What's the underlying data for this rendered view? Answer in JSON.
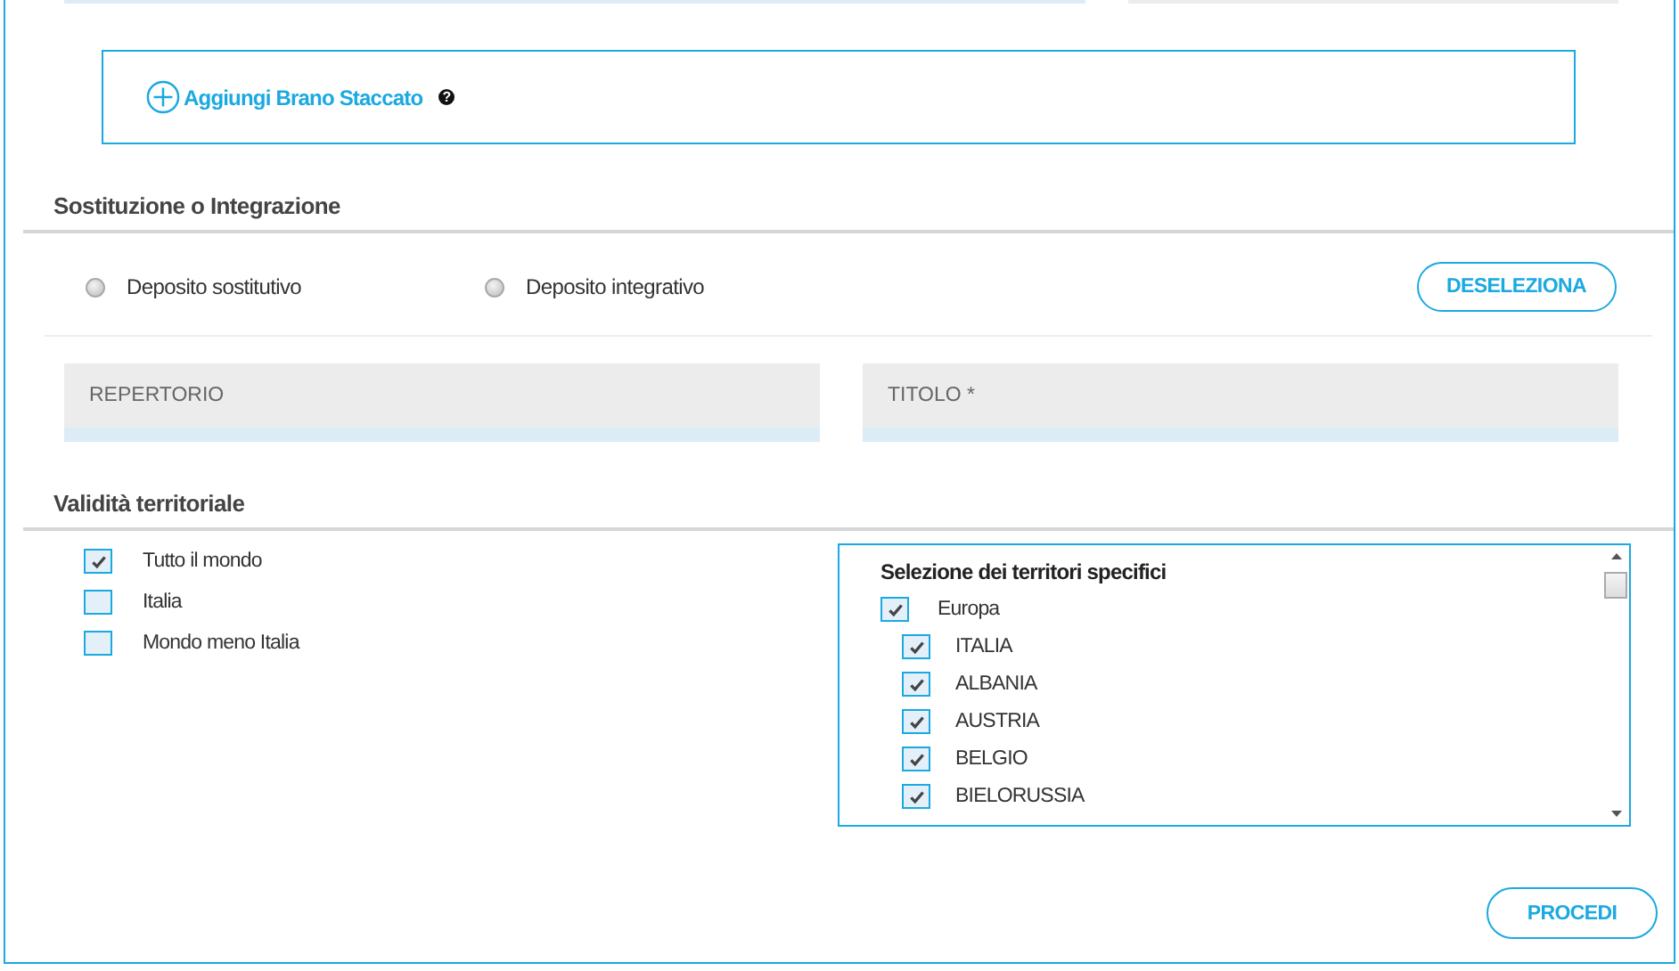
{
  "add_excerpt": {
    "label": "Aggiungi Brano Staccato",
    "help": "?"
  },
  "replacement": {
    "title": "Sostituzione o Integrazione",
    "options": [
      {
        "label": "Deposito sostitutivo",
        "selected": false
      },
      {
        "label": "Deposito integrativo",
        "selected": false
      }
    ],
    "clear_button": "DESELEZIONA"
  },
  "fields": [
    {
      "placeholder": "REPERTORIO"
    },
    {
      "placeholder": "TITOLO *"
    }
  ],
  "territorial": {
    "title": "Validità territoriale",
    "options": [
      {
        "label": "Tutto il mondo",
        "checked": true
      },
      {
        "label": "Italia",
        "checked": false
      },
      {
        "label": "Mondo meno Italia",
        "checked": false
      }
    ],
    "specific": {
      "title": "Selezione dei territori specifici",
      "items": [
        {
          "label": "Europa",
          "checked": true,
          "children": [
            {
              "label": "ITALIA",
              "checked": true
            },
            {
              "label": "ALBANIA",
              "checked": true
            },
            {
              "label": "AUSTRIA",
              "checked": true
            },
            {
              "label": "BELGIO",
              "checked": true
            },
            {
              "label": "BIELORUSSIA",
              "checked": true
            }
          ]
        }
      ]
    }
  },
  "proceed_button": "PROCEDI"
}
